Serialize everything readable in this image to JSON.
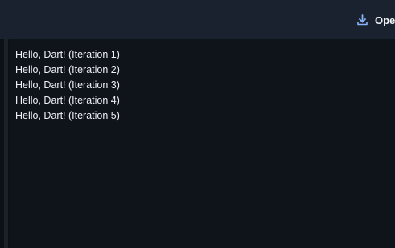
{
  "toolbar": {
    "open_label": "Ope",
    "open_icon": "download-icon"
  },
  "console": {
    "lines": [
      "Hello, Dart! (Iteration 1)",
      "Hello, Dart! (Iteration 2)",
      "Hello, Dart! (Iteration 3)",
      "Hello, Dart! (Iteration 4)",
      "Hello, Dart! (Iteration 5)"
    ]
  },
  "colors": {
    "toolbar_bg": "#1a2230",
    "console_bg": "#0f141b",
    "accent_icon": "#8ab4f8",
    "text": "#eef1f5"
  }
}
